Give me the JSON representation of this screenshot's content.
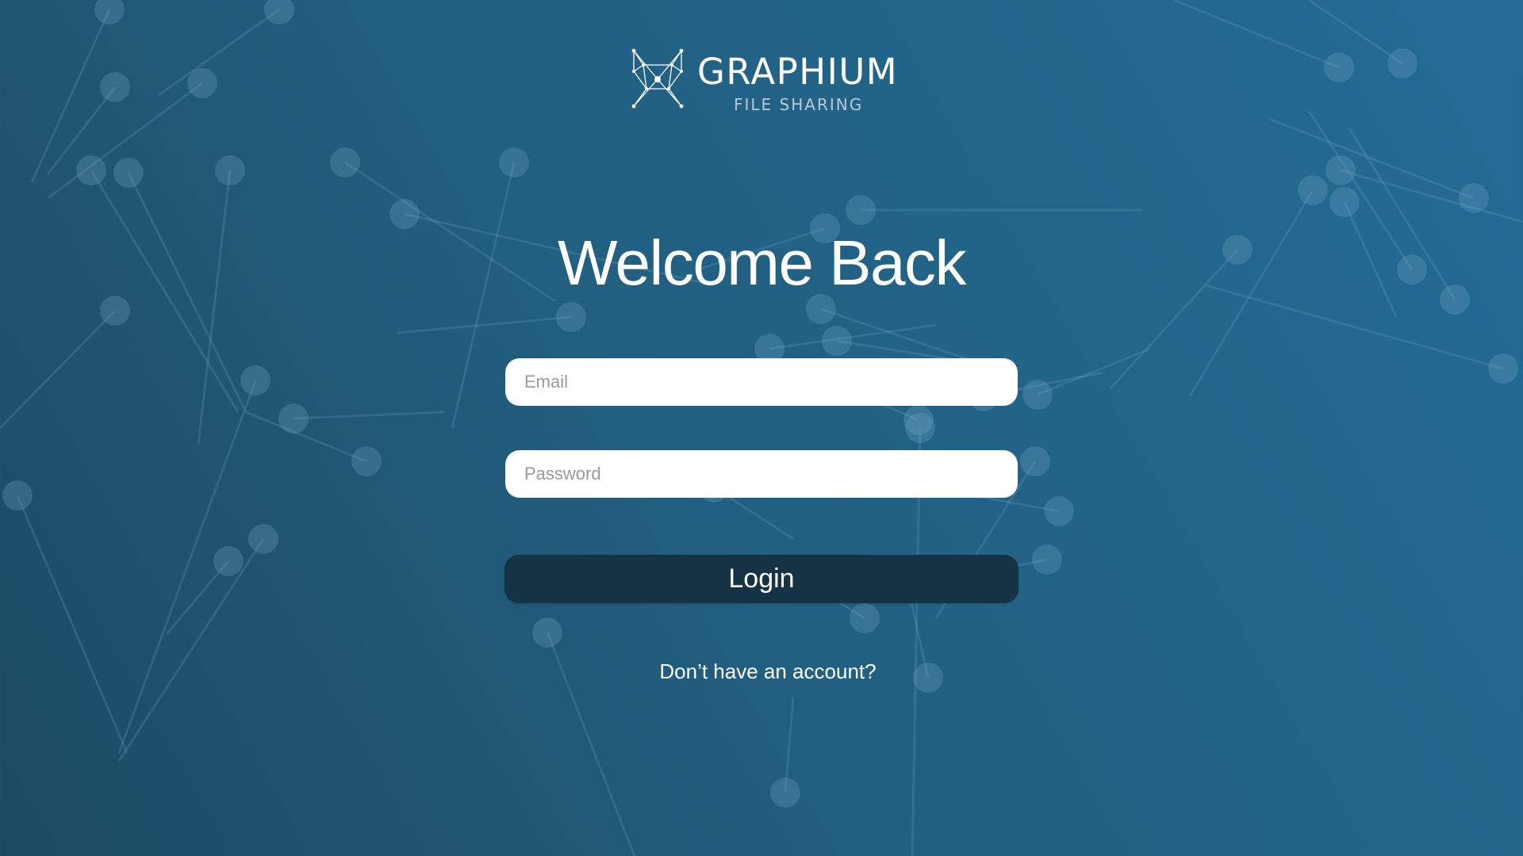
{
  "brand": {
    "name": "GRAPHIUM",
    "tagline": "FILE SHARING",
    "logo_icon": "network-graph-icon"
  },
  "heading": "Welcome Back",
  "form": {
    "email_placeholder": "Email",
    "email_value": "",
    "password_placeholder": "Password",
    "password_value": "",
    "login_label": "Login"
  },
  "signup_link": "Don’t have an account?",
  "colors": {
    "background_start": "#1d4a63",
    "background_end": "#236b96",
    "button": "#153345",
    "input": "#ffffff",
    "text": "#ffffff"
  },
  "background_decoration": "pin-network-pattern"
}
